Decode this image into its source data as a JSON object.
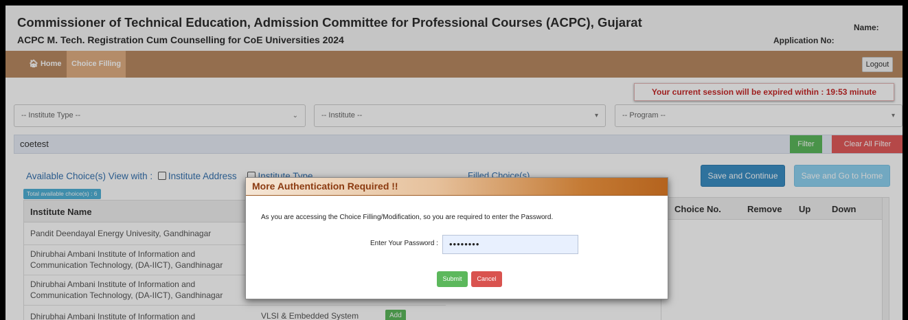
{
  "header": {
    "title": "Commissioner of Technical Education, Admission Committee for Professional Courses (ACPC), Gujarat",
    "subtitle": "ACPC M. Tech. Registration Cum Counselling for CoE Universities 2024",
    "name_label": "Name:",
    "application_label": "Application No:"
  },
  "nav": {
    "home_icon": "home-icon",
    "home_label": "Home",
    "choice_filling_label": "Choice Filling",
    "logout_label": "Logout"
  },
  "session_message": "Your current session will be expired within : 19:53 minute",
  "filters": {
    "institute_type_placeholder": "-- Institute Type --",
    "institute_placeholder": "-- Institute --",
    "program_placeholder": "-- Program --",
    "search_value": "coetest",
    "filter_label": "Filter",
    "clear_label": "Clear All Filter"
  },
  "available": {
    "heading_prefix": "Available Choice(s) View with :",
    "option_address": "Institute Address",
    "option_type": "Institute Type",
    "total_badge": "Total available choice(s) : 6",
    "column_institute": "Institute Name",
    "rows": [
      {
        "institute": "Pandit Deendayal Energy Univesity, Gandhinagar",
        "program": "",
        "add": ""
      },
      {
        "institute": "Dhirubhai Ambani Institute of Information and Communication Technology, (DA-IICT), Gandhinagar",
        "program": "",
        "add": ""
      },
      {
        "institute": "Dhirubhai Ambani Institute of Information and Communication Technology, (DA-IICT), Gandhinagar",
        "program": "",
        "add": ""
      },
      {
        "institute": "Dhirubhai Ambani Institute of Information and",
        "program": "VLSI & Embedded System",
        "add": "Add"
      }
    ]
  },
  "filled": {
    "heading": "Filled Choice(s)",
    "save_continue": "Save and Continue",
    "save_home": "Save and Go to Home",
    "columns": [
      "Choice No.",
      "Remove",
      "Up",
      "Down"
    ]
  },
  "modal": {
    "title": "More Authentication Required !!",
    "message": "As you are accessing the Choice Filling/Modification, so you are required to enter the Password.",
    "password_label": "Enter Your Password :",
    "password_value": "••••••••",
    "submit_label": "Submit",
    "cancel_label": "Cancel"
  },
  "colors": {
    "nav_bar": "#b98a62",
    "nav_active": "#e2b084",
    "accent_blue": "#3572b0",
    "success": "#5cb85c",
    "danger": "#d9534f"
  }
}
